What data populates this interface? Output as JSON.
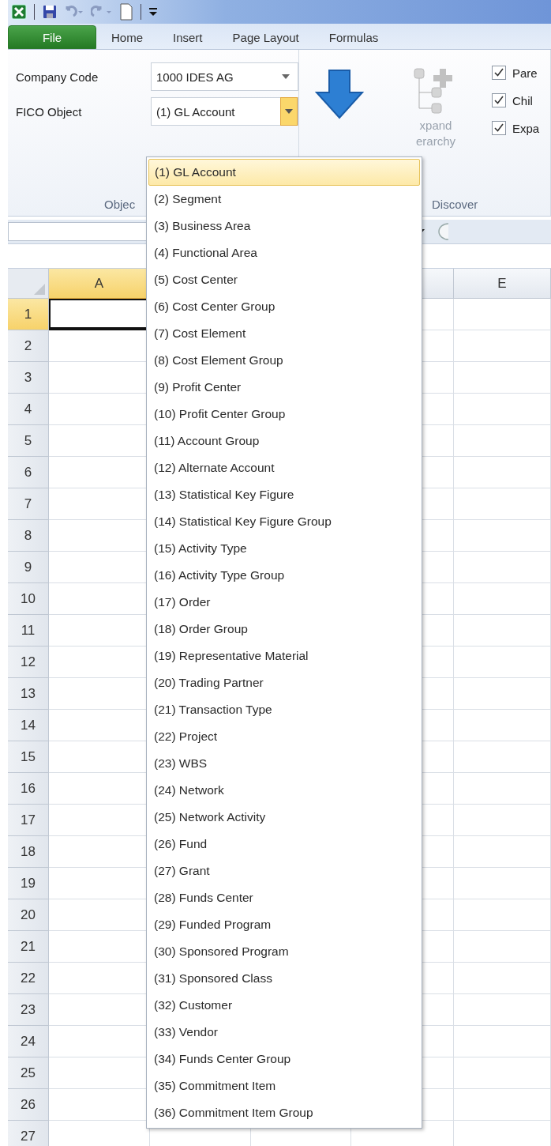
{
  "ribbon_tabs": [
    {
      "label": "File",
      "kind": "file",
      "selected": false
    },
    {
      "label": "Home",
      "kind": "tab",
      "selected": false
    },
    {
      "label": "Insert",
      "kind": "tab",
      "selected": false
    },
    {
      "label": "Page Layout",
      "kind": "tab",
      "selected": false
    },
    {
      "label": "Formulas",
      "kind": "tab",
      "selected": false
    }
  ],
  "object_group": {
    "label": "Objec",
    "company_code": {
      "label": "Company Code",
      "value": "1000 IDES AG"
    },
    "fico_object": {
      "label": "FICO Object",
      "value": "(1) GL Account",
      "expanded": true
    }
  },
  "discover_group": {
    "label": "Discover",
    "expand_hierarchy": {
      "lines": [
        "xpand",
        "erarchy"
      ],
      "disabled": true
    },
    "checkboxes": [
      {
        "label": "Pare",
        "checked": true
      },
      {
        "label": "Chil",
        "checked": true
      },
      {
        "label": "Expa",
        "checked": true
      }
    ]
  },
  "sheet": {
    "columns": [
      {
        "label": "A",
        "selected": true
      },
      {
        "label": "E",
        "selected": false
      }
    ],
    "rows": [
      {
        "label": "1",
        "selected": true
      },
      {
        "label": "2",
        "selected": false
      },
      {
        "label": "3",
        "selected": false
      },
      {
        "label": "4",
        "selected": false
      },
      {
        "label": "5",
        "selected": false
      },
      {
        "label": "6",
        "selected": false
      },
      {
        "label": "7",
        "selected": false
      },
      {
        "label": "8",
        "selected": false
      },
      {
        "label": "9",
        "selected": false
      },
      {
        "label": "10",
        "selected": false
      },
      {
        "label": "11",
        "selected": false
      },
      {
        "label": "12",
        "selected": false
      },
      {
        "label": "13",
        "selected": false
      },
      {
        "label": "14",
        "selected": false
      },
      {
        "label": "15",
        "selected": false
      },
      {
        "label": "16",
        "selected": false
      },
      {
        "label": "17",
        "selected": false
      },
      {
        "label": "18",
        "selected": false
      },
      {
        "label": "19",
        "selected": false
      },
      {
        "label": "20",
        "selected": false
      },
      {
        "label": "21",
        "selected": false
      },
      {
        "label": "22",
        "selected": false
      },
      {
        "label": "23",
        "selected": false
      },
      {
        "label": "24",
        "selected": false
      },
      {
        "label": "25",
        "selected": false
      },
      {
        "label": "26",
        "selected": false
      },
      {
        "label": "27",
        "selected": false
      }
    ]
  },
  "dropdown": {
    "items": [
      {
        "label": "(1) GL Account",
        "selected": true
      },
      {
        "label": "(2) Segment",
        "selected": false
      },
      {
        "label": "(3) Business Area",
        "selected": false
      },
      {
        "label": "(4) Functional Area",
        "selected": false
      },
      {
        "label": "(5) Cost Center",
        "selected": false
      },
      {
        "label": "(6) Cost Center Group",
        "selected": false
      },
      {
        "label": "(7) Cost Element",
        "selected": false
      },
      {
        "label": "(8) Cost Element Group",
        "selected": false
      },
      {
        "label": "(9) Profit Center",
        "selected": false
      },
      {
        "label": "(10) Profit Center Group",
        "selected": false
      },
      {
        "label": "(11) Account Group",
        "selected": false
      },
      {
        "label": "(12) Alternate Account",
        "selected": false
      },
      {
        "label": "(13) Statistical Key Figure",
        "selected": false
      },
      {
        "label": "(14) Statistical Key Figure Group",
        "selected": false
      },
      {
        "label": "(15) Activity Type",
        "selected": false
      },
      {
        "label": "(16) Activity Type Group",
        "selected": false
      },
      {
        "label": "(17) Order",
        "selected": false
      },
      {
        "label": "(18) Order Group",
        "selected": false
      },
      {
        "label": "(19) Representative Material",
        "selected": false
      },
      {
        "label": "(20) Trading Partner",
        "selected": false
      },
      {
        "label": "(21) Transaction Type",
        "selected": false
      },
      {
        "label": "(22) Project",
        "selected": false
      },
      {
        "label": "(23) WBS",
        "selected": false
      },
      {
        "label": "(24) Network",
        "selected": false
      },
      {
        "label": "(25) Network Activity",
        "selected": false
      },
      {
        "label": "(26) Fund",
        "selected": false
      },
      {
        "label": "(27) Grant",
        "selected": false
      },
      {
        "label": "(28) Funds Center",
        "selected": false
      },
      {
        "label": "(29) Funded Program",
        "selected": false
      },
      {
        "label": "(30) Sponsored Program",
        "selected": false
      },
      {
        "label": "(31) Sponsored Class",
        "selected": false
      },
      {
        "label": "(32) Customer",
        "selected": false
      },
      {
        "label": "(33) Vendor",
        "selected": false
      },
      {
        "label": "(34) Funds Center Group",
        "selected": false
      },
      {
        "label": "(35) Commitment Item",
        "selected": false
      },
      {
        "label": "(36) Commitment Item Group",
        "selected": false
      }
    ]
  }
}
